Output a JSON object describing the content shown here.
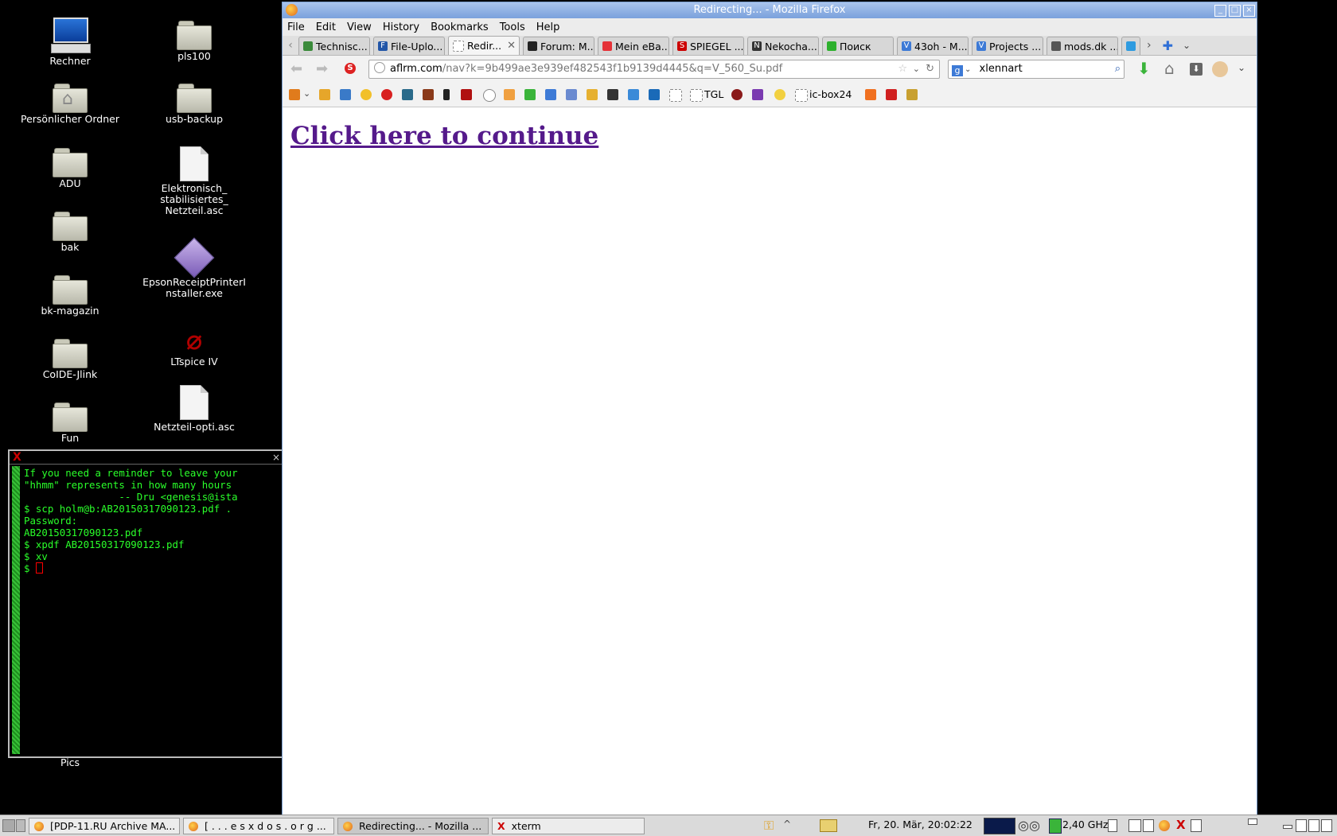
{
  "desktop": {
    "icons": [
      {
        "label": "Rechner"
      },
      {
        "label": "pls100"
      },
      {
        "label": "Persönlicher Ordner"
      },
      {
        "label": "usb-backup"
      },
      {
        "label": "ADU"
      },
      {
        "label": "Elektronisch_\nstabilisiertes_\nNetzteil.asc"
      },
      {
        "label": "bak"
      },
      {
        "label": "EpsonReceiptPrinterI\nnstaller.exe"
      },
      {
        "label": "bk-magazin"
      },
      {
        "label": "LTspice IV"
      },
      {
        "label": "CoIDE-Jlink"
      },
      {
        "label": "Netzteil-opti.asc"
      },
      {
        "label": "Fun"
      },
      {
        "label": "Pics"
      }
    ]
  },
  "xterm": {
    "lines": [
      "If you need a reminder to leave your",
      "\"hhmm\" represents in how many hours",
      "                -- Dru <genesis@ista",
      "$ scp holm@b:AB20150317090123.pdf .",
      "Password:",
      "AB20150317090123.pdf",
      "$ xpdf AB20150317090123.pdf",
      "$ xv",
      "$ "
    ]
  },
  "firefox": {
    "window_title": "Redirecting... - Mozilla Firefox",
    "menu": [
      "File",
      "Edit",
      "View",
      "History",
      "Bookmarks",
      "Tools",
      "Help"
    ],
    "tabs": [
      {
        "label": "Technisc..."
      },
      {
        "label": "File-Uplo..."
      },
      {
        "label": "Redir..."
      },
      {
        "label": "Forum: M..."
      },
      {
        "label": "Mein eBa..."
      },
      {
        "label": "SPIEGEL ..."
      },
      {
        "label": "Nekocha..."
      },
      {
        "label": "Поиск"
      },
      {
        "label": "43oh - M..."
      },
      {
        "label": "Projects ..."
      },
      {
        "label": "mods.dk ..."
      }
    ],
    "url_domain": "aflrm.com",
    "url_rest": "/nav?k=9b499ae3e939ef482543f1b9139d4445&q=V_560_Su.pdf",
    "search_value": "xlennart",
    "bookmarks_text": [
      "TGL",
      "ic-box24"
    ],
    "content_link": "Click here to continue"
  },
  "taskbar": {
    "tasks": [
      {
        "label": "[PDP-11.RU Archive MA..."
      },
      {
        "label": "[ . . . e s x d o s . o r g ..."
      },
      {
        "label": "Redirecting... - Mozilla ..."
      },
      {
        "label": "xterm"
      }
    ],
    "clock": "Fr, 20. Mär, 20:02:22",
    "cpu_freq": "2,40 GHz"
  }
}
